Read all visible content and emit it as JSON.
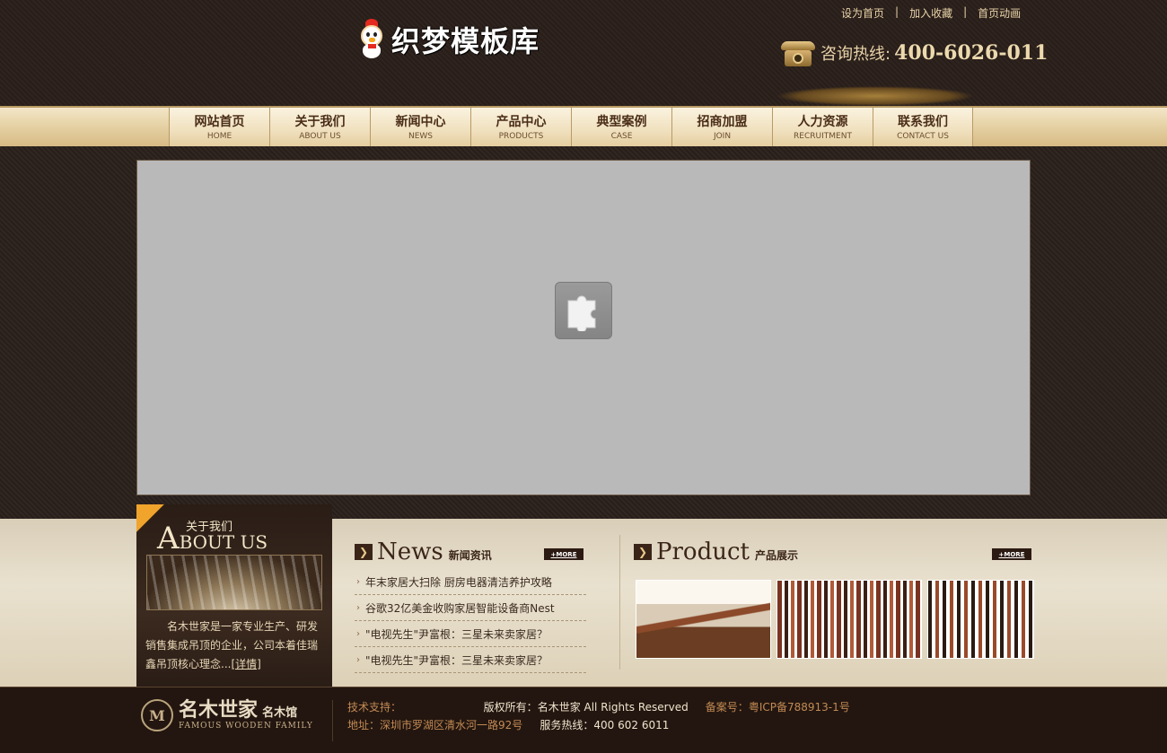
{
  "header": {
    "logo_text": "织梦模板库",
    "top_links": [
      "设为首页",
      "加入收藏",
      "首页动画"
    ],
    "top_link_separator": "|",
    "hotline_label": "咨询热线:",
    "hotline_number": "400-6026-011"
  },
  "nav": {
    "items": [
      {
        "cn": "网站首页",
        "en": "HOME"
      },
      {
        "cn": "关于我们",
        "en": "ABOUT US"
      },
      {
        "cn": "新闻中心",
        "en": "NEWS"
      },
      {
        "cn": "产品中心",
        "en": "PRODUCTS"
      },
      {
        "cn": "典型案例",
        "en": "CASE"
      },
      {
        "cn": "招商加盟",
        "en": "JOIN"
      },
      {
        "cn": "人力资源",
        "en": "RECRUITMENT"
      },
      {
        "cn": "联系我们",
        "en": "CONTACT US"
      }
    ]
  },
  "banner": {
    "plugin_icon": "puzzle-plugin-icon"
  },
  "about": {
    "title_cn": "关于我们",
    "title_en_initial": "A",
    "title_en_rest": "BOUT US",
    "text": "名木世家是一家专业生产、研发销售集成吊顶的企业，公司本着佳瑞鑫吊顶核心理念...",
    "more": "[详情]"
  },
  "news": {
    "title_en": "News",
    "title_cn": "新闻资讯",
    "more": "+MORE",
    "items": [
      "年末家居大扫除 厨房电器清洁养护攻略",
      "谷歌32亿美金收购家居智能设备商Nest",
      "\"电视先生\"尹富根：三星未来卖家居？",
      "\"电视先生\"尹富根：三星未来卖家居？"
    ]
  },
  "product": {
    "title_en": "Product",
    "title_cn": "产品展示",
    "more": "+MORE"
  },
  "footer": {
    "badge": "M",
    "brand_cn": "名木世家",
    "brand_sub": "名木馆",
    "brand_en": "FAMOUS WOODEN FAMILY",
    "tech_label": "技术支持：",
    "copyright_label": "版权所有：",
    "copyright_value": "名木世家 All Rights Reserved",
    "icp_label": "备案号：",
    "icp_value": "粤ICP备788913-1号",
    "address_label": "地址：",
    "address_value": "深圳市罗湖区清水河一路92号",
    "service_label": "服务热线：",
    "service_value": "400 602 6011"
  }
}
